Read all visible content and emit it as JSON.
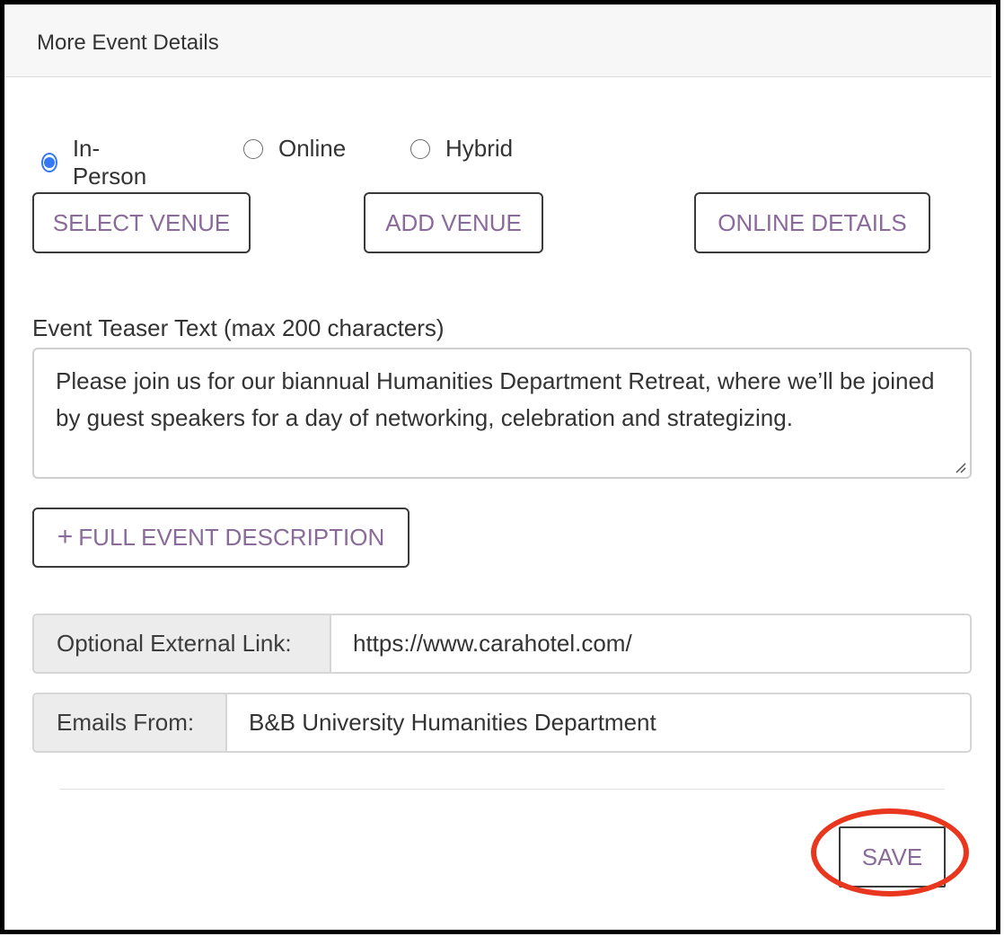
{
  "header": {
    "title": "More Event Details"
  },
  "event_type": {
    "options": [
      {
        "label": "In-Person",
        "checked": true
      },
      {
        "label": "Online",
        "checked": false
      },
      {
        "label": "Hybrid",
        "checked": false
      }
    ]
  },
  "venue_buttons": {
    "select_venue": "SELECT VENUE",
    "add_venue": "ADD VENUE",
    "online_details": "ONLINE DETAILS"
  },
  "teaser": {
    "label": "Event Teaser Text (max 200 characters)",
    "value": "Please join us for our biannual Humanities Department Retreat, where we’ll be joined by guest speakers for a day of networking, celebration and strategizing."
  },
  "full_description_button": {
    "icon": "+",
    "label": "FULL EVENT DESCRIPTION"
  },
  "external_link": {
    "label": "Optional External Link:",
    "value": "https://www.carahotel.com/"
  },
  "emails_from": {
    "label": "Emails From:",
    "value": "B&B University Humanities Department"
  },
  "footer": {
    "save_label": "SAVE"
  },
  "colors": {
    "accent_text": "#8a6a9b",
    "radio_checked": "#3478f6",
    "highlight": "#e8361f"
  }
}
